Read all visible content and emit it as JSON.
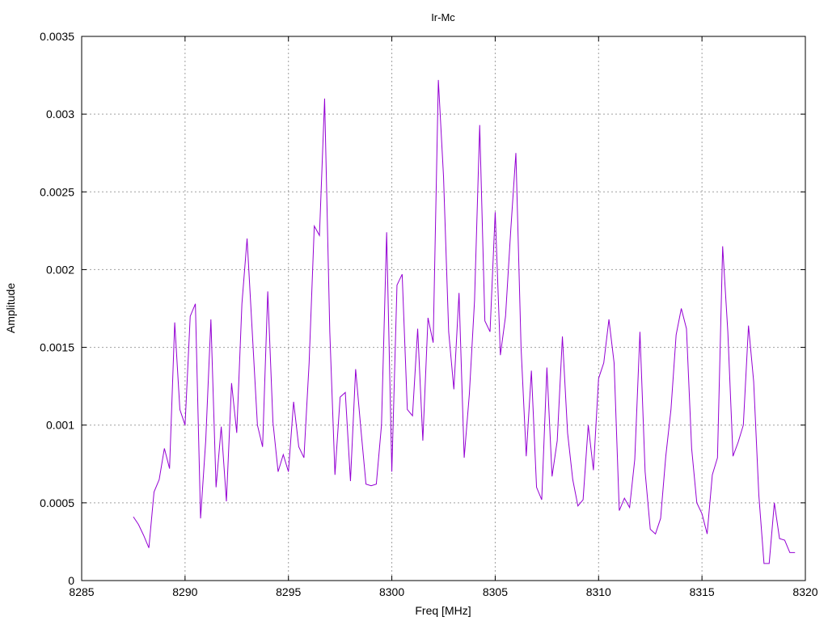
{
  "chart_data": {
    "type": "line",
    "title": "Ir-Mc",
    "xlabel": "Freq [MHz]",
    "ylabel": "Amplitude",
    "xlim": [
      8285,
      8320
    ],
    "ylim": [
      0,
      0.0035
    ],
    "xticks": [
      "8285",
      "8290",
      "8295",
      "8300",
      "8305",
      "8310",
      "8315",
      "8320"
    ],
    "yticks": [
      "0",
      "0.0005",
      "0.001",
      "0.0015",
      "0.002",
      "0.0025",
      "0.003",
      "0.0035"
    ],
    "grid": true,
    "line_color": "#9400d3",
    "x": [
      8287.5,
      8287.75,
      8288.0,
      8288.25,
      8288.5,
      8288.75,
      8289.0,
      8289.25,
      8289.5,
      8289.75,
      8290.0,
      8290.25,
      8290.5,
      8290.75,
      8291.0,
      8291.25,
      8291.5,
      8291.75,
      8292.0,
      8292.25,
      8292.5,
      8292.75,
      8293.0,
      8293.25,
      8293.5,
      8293.75,
      8294.0,
      8294.25,
      8294.5,
      8294.75,
      8295.0,
      8295.25,
      8295.5,
      8295.75,
      8296.0,
      8296.25,
      8296.5,
      8296.75,
      8297.0,
      8297.25,
      8297.5,
      8297.75,
      8298.0,
      8298.25,
      8298.5,
      8298.75,
      8299.0,
      8299.25,
      8299.5,
      8299.75,
      8300.0,
      8300.25,
      8300.5,
      8300.75,
      8301.0,
      8301.25,
      8301.5,
      8301.75,
      8302.0,
      8302.25,
      8302.5,
      8302.75,
      8303.0,
      8303.25,
      8303.5,
      8303.75,
      8304.0,
      8304.25,
      8304.5,
      8304.75,
      8305.0,
      8305.25,
      8305.5,
      8305.75,
      8306.0,
      8306.25,
      8306.5,
      8306.75,
      8307.0,
      8307.25,
      8307.5,
      8307.75,
      8308.0,
      8308.25,
      8308.5,
      8308.75,
      8309.0,
      8309.25,
      8309.5,
      8309.75,
      8310.0,
      8310.25,
      8310.5,
      8310.75,
      8311.0,
      8311.25,
      8311.5,
      8311.75,
      8312.0,
      8312.25,
      8312.5,
      8312.75,
      8313.0,
      8313.25,
      8313.5,
      8313.75,
      8314.0,
      8314.25,
      8314.5,
      8314.75,
      8315.0,
      8315.25,
      8315.5,
      8315.75,
      8316.0,
      8316.25,
      8316.5,
      8316.75,
      8317.0,
      8317.25,
      8317.5,
      8317.75,
      8318.0,
      8318.25,
      8318.5,
      8318.75,
      8319.0,
      8319.25,
      8319.5
    ],
    "series": [
      {
        "values": [
          0.00041,
          0.00036,
          0.00029,
          0.00021,
          0.00057,
          0.00065,
          0.00085,
          0.00072,
          0.00166,
          0.0011,
          0.001,
          0.0017,
          0.00178,
          0.0004,
          0.0009,
          0.00168,
          0.0006,
          0.00099,
          0.00051,
          0.00127,
          0.00095,
          0.00178,
          0.0022,
          0.0016,
          0.001,
          0.00086,
          0.00186,
          0.00102,
          0.0007,
          0.00081,
          0.0007,
          0.00115,
          0.00086,
          0.00079,
          0.0014,
          0.00228,
          0.00222,
          0.0031,
          0.0016,
          0.00068,
          0.00118,
          0.00121,
          0.00064,
          0.00136,
          0.00098,
          0.00062,
          0.00061,
          0.00062,
          0.001,
          0.00224,
          0.0007,
          0.0019,
          0.00197,
          0.0011,
          0.00106,
          0.00162,
          0.0009,
          0.00169,
          0.00153,
          0.00322,
          0.0026,
          0.0016,
          0.00123,
          0.00185,
          0.00079,
          0.0012,
          0.0018,
          0.00293,
          0.00167,
          0.0016,
          0.00237,
          0.00145,
          0.0017,
          0.00225,
          0.00275,
          0.0015,
          0.0008,
          0.00135,
          0.0006,
          0.00052,
          0.00137,
          0.00067,
          0.0009,
          0.00157,
          0.00095,
          0.00065,
          0.00048,
          0.00052,
          0.001,
          0.00071,
          0.0013,
          0.0014,
          0.00168,
          0.0014,
          0.00045,
          0.00053,
          0.00047,
          0.00078,
          0.0016,
          0.0007,
          0.00033,
          0.0003,
          0.0004,
          0.0008,
          0.0011,
          0.00158,
          0.00175,
          0.00162,
          0.00085,
          0.0005,
          0.00043,
          0.0003,
          0.00068,
          0.00079,
          0.00215,
          0.0016,
          0.0008,
          0.00089,
          0.001,
          0.00164,
          0.00128,
          0.00055,
          0.00011,
          0.00011,
          0.0005,
          0.00027,
          0.00026,
          0.00018,
          0.00018
        ]
      }
    ]
  }
}
